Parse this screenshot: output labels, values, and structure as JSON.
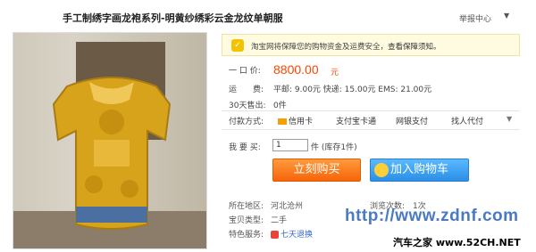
{
  "header": {
    "title": "手工制绣字画龙袍系列-明黄纱绣彩云金龙纹单朝服",
    "report_label": "举报中心",
    "report_caret": "▼"
  },
  "promo": {
    "icon": "shield-icon",
    "text": "淘宝网将保障您的购物资金及运费安全，",
    "link": "查看保障须知。"
  },
  "price": {
    "label": "一 口 价:",
    "value": "8800.00",
    "unit": "元"
  },
  "shipping": {
    "label": "运　　费:",
    "value": "平邮: 9.00元 快递: 15.00元 EMS: 21.00元"
  },
  "sales": {
    "label": "30天售出:",
    "value": "0件"
  },
  "payment": {
    "label": "付款方式:",
    "items": [
      "信用卡",
      "支付宝卡通",
      "网银支付",
      "找人代付"
    ],
    "caret": "▼"
  },
  "quantity": {
    "label": "我 要 买:",
    "value": "1",
    "unit": "件 (库存1件)"
  },
  "buttons": {
    "buy_now": "立刻购买",
    "add_to_cart": "加入购物车"
  },
  "details": {
    "location_label": "所在地区:",
    "location_value": "河北沧州",
    "views_label": "浏览次数:",
    "views_value": "1次",
    "type_label": "宝贝类型:",
    "type_value": "二手",
    "service_label": "特色服务:",
    "service_value": "七天退换"
  },
  "watermark": {
    "url": "http://www.zdnf.com",
    "bottom": "汽车之家 www.52CH.NET"
  },
  "colors": {
    "price": "#ff4400",
    "buy_button": "#f7640a",
    "cart_button": "#2b8fe6",
    "promo_bg": "#fffbe0"
  }
}
